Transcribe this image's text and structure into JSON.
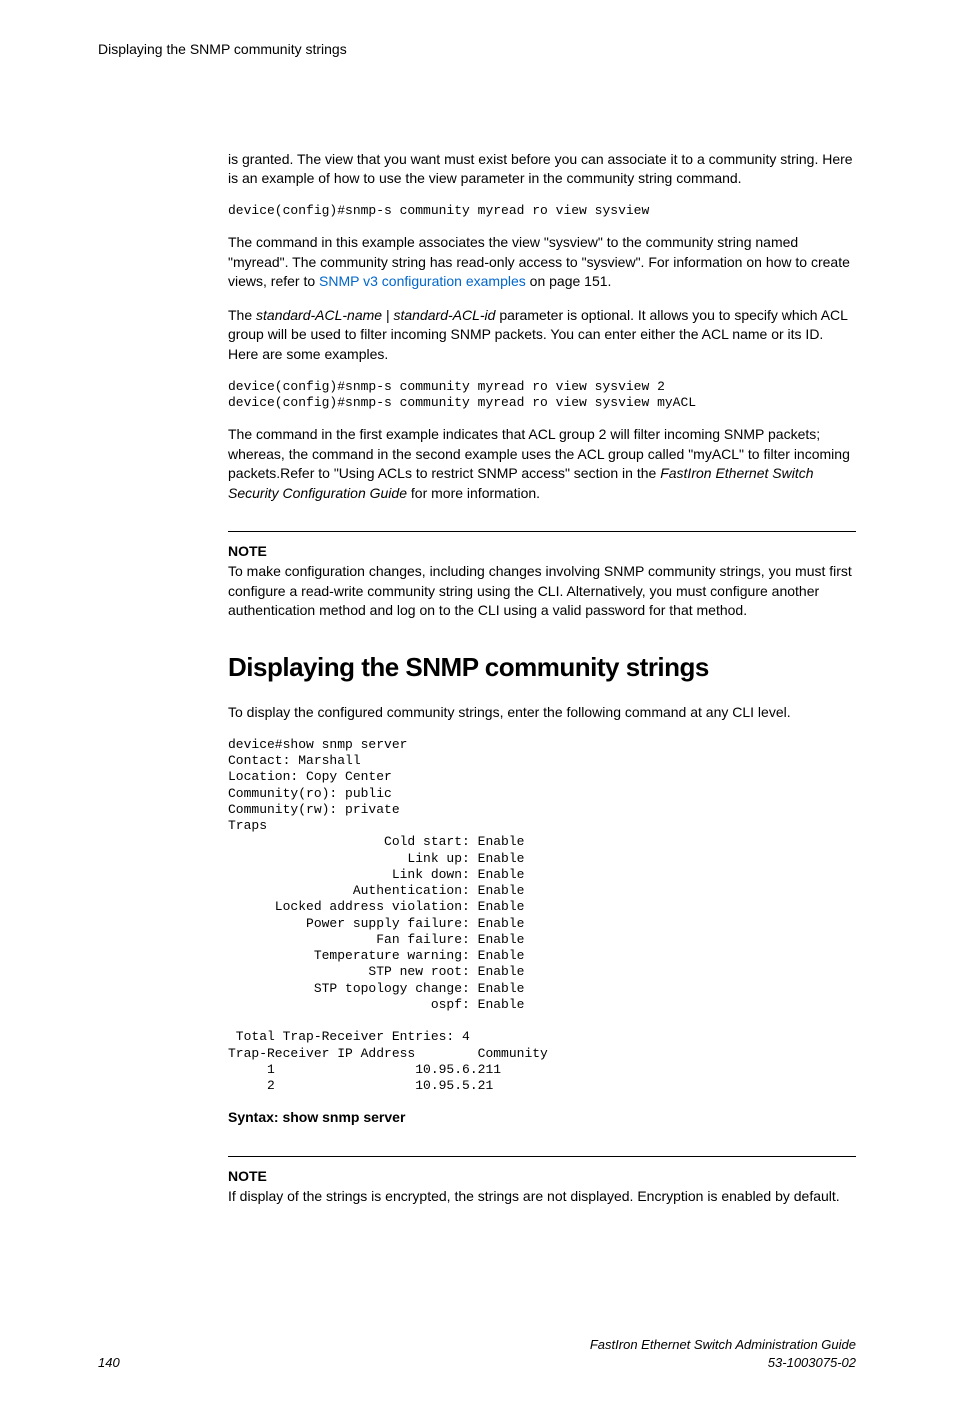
{
  "header": {
    "title": "Displaying the SNMP community strings"
  },
  "body": {
    "intro_para": "is granted. The view that you want must exist before you can associate it to a community string. Here is an example of how to use the view parameter in the community string command.",
    "code1": "device(config)#snmp-s community myread ro view sysview",
    "para2_a": "The command in this example associates the view \"sysview\" to the community string named \"myread\". The community string has read-only access to \"sysview\". For information on how to create views, refer to ",
    "link_text": "SNMP v3 configuration examples",
    "para2_b": " on page 151.",
    "para3_a": "The ",
    "para3_em1": "standard-ACL-name",
    "para3_b": " | ",
    "para3_em2": "standard-ACL-id",
    "para3_c": " parameter is optional. It allows you to specify which ACL group will be used to filter incoming SNMP packets. You can enter either the ACL name or its ID. Here are some examples.",
    "code2": "device(config)#snmp-s community myread ro view sysview 2\ndevice(config)#snmp-s community myread ro view sysview myACL",
    "para4_a": "The command in the first example indicates that ACL group 2 will filter incoming SNMP packets; whereas, the command in the second example uses the ACL group called \"myACL\" to filter incoming packets.Refer to \"Using ACLs to restrict SNMP access\" section in the ",
    "para4_em": "FastIron Ethernet Switch Security Configuration Guide",
    "para4_b": " for more information.",
    "note1_label": "NOTE",
    "note1_body": "To make configuration changes, including changes involving SNMP community strings, you must first configure a read-write community string using the CLI. Alternatively, you must configure another authentication method and log on to the CLI using a valid password for that method.",
    "h1": "Displaying the SNMP community strings",
    "para5": "To display the configured community strings, enter the following command at any CLI level.",
    "code3": "device#show snmp server\nContact: Marshall\nLocation: Copy Center\nCommunity(ro): public\nCommunity(rw): private\nTraps\n                    Cold start: Enable\n                       Link up: Enable\n                     Link down: Enable\n                Authentication: Enable\n      Locked address violation: Enable\n          Power supply failure: Enable\n                   Fan failure: Enable\n           Temperature warning: Enable\n                  STP new root: Enable\n           STP topology change: Enable\n                          ospf: Enable\n\n Total Trap-Receiver Entries: 4         \nTrap-Receiver IP Address        Community\n     1                  10.95.6.211\n     2                  10.95.5.21",
    "syntax": "Syntax: show snmp server",
    "note2_label": "NOTE",
    "note2_body": "If display of the strings is encrypted, the strings are not displayed. Encryption is enabled by default."
  },
  "footer": {
    "page": "140",
    "title": "FastIron Ethernet Switch Administration Guide",
    "doc": "53-1003075-02"
  }
}
